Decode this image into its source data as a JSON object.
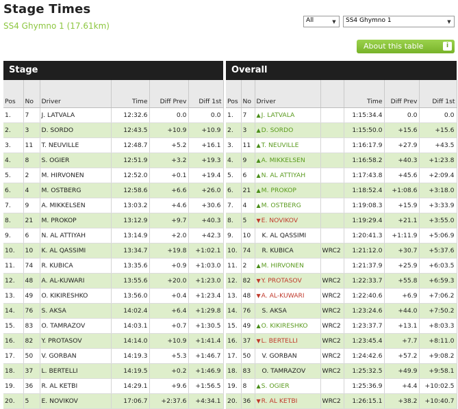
{
  "header": {
    "title": "Stage Times",
    "subtitle": "SS4 Ghymno 1 (17.61km)"
  },
  "filters": {
    "class_value": "All",
    "stage_value": "SS4 Ghymno 1"
  },
  "about_button": {
    "label": "About this table",
    "icon": "info-icon"
  },
  "sections": {
    "stage": "Stage",
    "overall": "Overall"
  },
  "stage_columns": {
    "pos": "Pos",
    "no": "No",
    "driver": "Driver",
    "time": "Time",
    "diff_prev": "Diff Prev",
    "diff_first": "Diff 1st"
  },
  "overall_columns": {
    "pos": "Pos",
    "no": "No",
    "driver": "Driver",
    "time": "Time",
    "diff_prev": "Diff Prev",
    "diff_first": "Diff 1st"
  },
  "colors": {
    "accent_green": "#8cc63f",
    "row_alt": "#deeecb",
    "header_bar": "#1f1f1f",
    "gain": "#5a9a1e",
    "loss": "#c0392b"
  },
  "stage_rows": [
    {
      "pos": "1.",
      "no": "7",
      "driver": "J. LATVALA",
      "time": "12:32.6",
      "diff_prev": "0.0",
      "diff_first": "0.0"
    },
    {
      "pos": "2.",
      "no": "3",
      "driver": "D. SORDO",
      "time": "12:43.5",
      "diff_prev": "+10.9",
      "diff_first": "+10.9"
    },
    {
      "pos": "3.",
      "no": "11",
      "driver": "T. NEUVILLE",
      "time": "12:48.7",
      "diff_prev": "+5.2",
      "diff_first": "+16.1"
    },
    {
      "pos": "4.",
      "no": "8",
      "driver": "S. OGIER",
      "time": "12:51.9",
      "diff_prev": "+3.2",
      "diff_first": "+19.3"
    },
    {
      "pos": "5.",
      "no": "2",
      "driver": "M. HIRVONEN",
      "time": "12:52.0",
      "diff_prev": "+0.1",
      "diff_first": "+19.4"
    },
    {
      "pos": "6.",
      "no": "4",
      "driver": "M. OSTBERG",
      "time": "12:58.6",
      "diff_prev": "+6.6",
      "diff_first": "+26.0"
    },
    {
      "pos": "7.",
      "no": "9",
      "driver": "A. MIKKELSEN",
      "time": "13:03.2",
      "diff_prev": "+4.6",
      "diff_first": "+30.6"
    },
    {
      "pos": "8.",
      "no": "21",
      "driver": "M. PROKOP",
      "time": "13:12.9",
      "diff_prev": "+9.7",
      "diff_first": "+40.3"
    },
    {
      "pos": "9.",
      "no": "6",
      "driver": "N. AL ATTIYAH",
      "time": "13:14.9",
      "diff_prev": "+2.0",
      "diff_first": "+42.3"
    },
    {
      "pos": "10.",
      "no": "10",
      "driver": "K. AL QASSIMI",
      "time": "13:34.7",
      "diff_prev": "+19.8",
      "diff_first": "+1:02.1"
    },
    {
      "pos": "11.",
      "no": "74",
      "driver": "R. KUBICA",
      "time": "13:35.6",
      "diff_prev": "+0.9",
      "diff_first": "+1:03.0"
    },
    {
      "pos": "12.",
      "no": "48",
      "driver": "A. AL-KUWARI",
      "time": "13:55.6",
      "diff_prev": "+20.0",
      "diff_first": "+1:23.0"
    },
    {
      "pos": "13.",
      "no": "49",
      "driver": "O. KIKIRESHKO",
      "time": "13:56.0",
      "diff_prev": "+0.4",
      "diff_first": "+1:23.4"
    },
    {
      "pos": "14.",
      "no": "76",
      "driver": "S. AKSA",
      "time": "14:02.4",
      "diff_prev": "+6.4",
      "diff_first": "+1:29.8"
    },
    {
      "pos": "15.",
      "no": "83",
      "driver": "O. TAMRAZOV",
      "time": "14:03.1",
      "diff_prev": "+0.7",
      "diff_first": "+1:30.5"
    },
    {
      "pos": "16.",
      "no": "82",
      "driver": "Y. PROTASOV",
      "time": "14:14.0",
      "diff_prev": "+10.9",
      "diff_first": "+1:41.4"
    },
    {
      "pos": "17.",
      "no": "50",
      "driver": "V. GORBAN",
      "time": "14:19.3",
      "diff_prev": "+5.3",
      "diff_first": "+1:46.7"
    },
    {
      "pos": "18.",
      "no": "37",
      "driver": "L. BERTELLI",
      "time": "14:19.5",
      "diff_prev": "+0.2",
      "diff_first": "+1:46.9"
    },
    {
      "pos": "19.",
      "no": "36",
      "driver": "R. AL KETBI",
      "time": "14:29.1",
      "diff_prev": "+9.6",
      "diff_first": "+1:56.5"
    },
    {
      "pos": "20.",
      "no": "5",
      "driver": "E. NOVIKOV",
      "time": "17:06.7",
      "diff_prev": "+2:37.6",
      "diff_first": "+4:34.1"
    }
  ],
  "overall_rows": [
    {
      "pos": "1.",
      "no": "7",
      "trend": "up",
      "driver": "J. LATVALA",
      "class": "",
      "time": "1:15:34.4",
      "diff_prev": "0.0",
      "diff_first": "0.0"
    },
    {
      "pos": "2.",
      "no": "3",
      "trend": "up",
      "driver": "D. SORDO",
      "class": "",
      "time": "1:15:50.0",
      "diff_prev": "+15.6",
      "diff_first": "+15.6"
    },
    {
      "pos": "3.",
      "no": "11",
      "trend": "up",
      "driver": "T. NEUVILLE",
      "class": "",
      "time": "1:16:17.9",
      "diff_prev": "+27.9",
      "diff_first": "+43.5"
    },
    {
      "pos": "4.",
      "no": "9",
      "trend": "up",
      "driver": "A. MIKKELSEN",
      "class": "",
      "time": "1:16:58.2",
      "diff_prev": "+40.3",
      "diff_first": "+1:23.8"
    },
    {
      "pos": "5.",
      "no": "6",
      "trend": "up",
      "driver": "N. AL ATTIYAH",
      "class": "",
      "time": "1:17:43.8",
      "diff_prev": "+45.6",
      "diff_first": "+2:09.4"
    },
    {
      "pos": "6.",
      "no": "21",
      "trend": "up",
      "driver": "M. PROKOP",
      "class": "",
      "time": "1:18:52.4",
      "diff_prev": "+1:08.6",
      "diff_first": "+3:18.0"
    },
    {
      "pos": "7.",
      "no": "4",
      "trend": "up",
      "driver": "M. OSTBERG",
      "class": "",
      "time": "1:19:08.3",
      "diff_prev": "+15.9",
      "diff_first": "+3:33.9"
    },
    {
      "pos": "8.",
      "no": "5",
      "trend": "down",
      "driver": "E. NOVIKOV",
      "class": "",
      "time": "1:19:29.4",
      "diff_prev": "+21.1",
      "diff_first": "+3:55.0"
    },
    {
      "pos": "9.",
      "no": "10",
      "trend": "none",
      "driver": "K. AL QASSIMI",
      "class": "",
      "time": "1:20:41.3",
      "diff_prev": "+1:11.9",
      "diff_first": "+5:06.9"
    },
    {
      "pos": "10.",
      "no": "74",
      "trend": "none",
      "driver": "R. KUBICA",
      "class": "WRC2",
      "time": "1:21:12.0",
      "diff_prev": "+30.7",
      "diff_first": "+5:37.6"
    },
    {
      "pos": "11.",
      "no": "2",
      "trend": "up",
      "driver": "M. HIRVONEN",
      "class": "",
      "time": "1:21:37.9",
      "diff_prev": "+25.9",
      "diff_first": "+6:03.5"
    },
    {
      "pos": "12.",
      "no": "82",
      "trend": "down",
      "driver": "Y. PROTASOV",
      "class": "WRC2",
      "time": "1:22:33.7",
      "diff_prev": "+55.8",
      "diff_first": "+6:59.3"
    },
    {
      "pos": "13.",
      "no": "48",
      "trend": "down",
      "driver": "A. AL-KUWARI",
      "class": "WRC2",
      "time": "1:22:40.6",
      "diff_prev": "+6.9",
      "diff_first": "+7:06.2"
    },
    {
      "pos": "14.",
      "no": "76",
      "trend": "none",
      "driver": "S. AKSA",
      "class": "WRC2",
      "time": "1:23:24.6",
      "diff_prev": "+44.0",
      "diff_first": "+7:50.2"
    },
    {
      "pos": "15.",
      "no": "49",
      "trend": "up",
      "driver": "O. KIKIRESHKO",
      "class": "WRC2",
      "time": "1:23:37.7",
      "diff_prev": "+13.1",
      "diff_first": "+8:03.3"
    },
    {
      "pos": "16.",
      "no": "37",
      "trend": "down",
      "driver": "L. BERTELLI",
      "class": "WRC2",
      "time": "1:23:45.4",
      "diff_prev": "+7.7",
      "diff_first": "+8:11.0"
    },
    {
      "pos": "17.",
      "no": "50",
      "trend": "none",
      "driver": "V. GORBAN",
      "class": "WRC2",
      "time": "1:24:42.6",
      "diff_prev": "+57.2",
      "diff_first": "+9:08.2"
    },
    {
      "pos": "18.",
      "no": "83",
      "trend": "none",
      "driver": "O. TAMRAZOV",
      "class": "WRC2",
      "time": "1:25:32.5",
      "diff_prev": "+49.9",
      "diff_first": "+9:58.1"
    },
    {
      "pos": "19.",
      "no": "8",
      "trend": "up",
      "driver": "S. OGIER",
      "class": "",
      "time": "1:25:36.9",
      "diff_prev": "+4.4",
      "diff_first": "+10:02.5"
    },
    {
      "pos": "20.",
      "no": "36",
      "trend": "down",
      "driver": "R. AL KETBI",
      "class": "WRC2",
      "time": "1:26:15.1",
      "diff_prev": "+38.2",
      "diff_first": "+10:40.7"
    }
  ]
}
